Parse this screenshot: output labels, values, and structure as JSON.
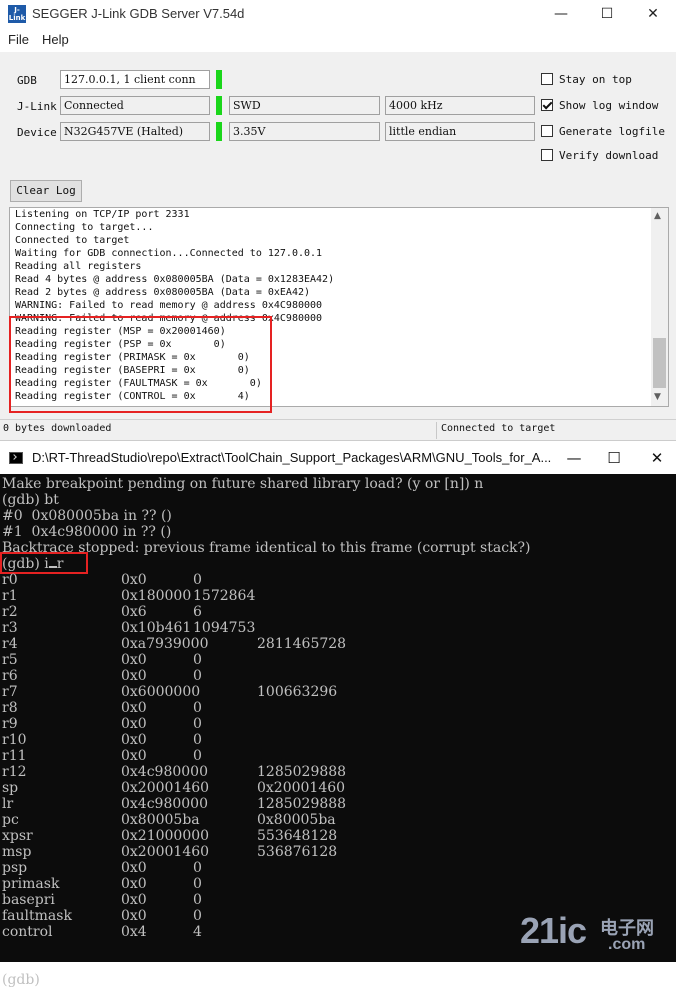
{
  "server": {
    "title": "SEGGER J-Link GDB Server V7.54d",
    "icon_text": "J-Link GDB",
    "menu": [
      "File",
      "Help"
    ],
    "labels": {
      "gdb": "GDB",
      "jlink": "J-Link",
      "device": "Device"
    },
    "fields": {
      "gdb": "127.0.0.1, 1 client conn",
      "jlink": "Connected",
      "interface": "SWD",
      "speed": "4000 kHz",
      "device": "N32G457VE (Halted)",
      "voltage": "3.35V",
      "endian": "little endian"
    },
    "options": [
      {
        "label": "Stay on top",
        "checked": false
      },
      {
        "label": "Show log window",
        "checked": true
      },
      {
        "label": "Generate logfile",
        "checked": false
      },
      {
        "label": "Verify download",
        "checked": false
      }
    ],
    "clear_log": "Clear Log",
    "log": [
      "Listening on TCP/IP port 2331",
      "Connecting to target...",
      "Connected to target",
      "Waiting for GDB connection...Connected to 127.0.0.1",
      "Reading all registers",
      "Read 4 bytes @ address 0x080005BA (Data = 0x1283EA42)",
      "Read 2 bytes @ address 0x080005BA (Data = 0xEA42)",
      "WARNING: Failed to read memory @ address 0x4C980000",
      "WARNING: Failed to read memory @ address 0x4C980000",
      "Reading register (MSP = 0x20001460)",
      "Reading register (PSP = 0x       0)",
      "Reading register (PRIMASK = 0x       0)",
      "Reading register (BASEPRI = 0x       0)",
      "Reading register (FAULTMASK = 0x       0)",
      "Reading register (CONTROL = 0x       4)"
    ],
    "status_left": "0 bytes downloaded",
    "status_right": "Connected to target",
    "colors": {
      "led": "#1ad61a",
      "highlight": "#e52222"
    }
  },
  "console": {
    "title": "D:\\RT-ThreadStudio\\repo\\Extract\\ToolChain_Support_Packages\\ARM\\GNU_Tools_for_A...",
    "lines": [
      "Make breakpoint pending on future shared library load? (y or [n]) n",
      "(gdb) bt",
      "#0  0x080005ba in ?? ()",
      "#1  0x4c980000 in ?? ()",
      "Backtrace stopped: previous frame identical to this frame (corrupt stack?)"
    ],
    "prompt_prefix": "(gdb) i",
    "prompt_suffix": "r",
    "registers": [
      {
        "name": "r0",
        "hex": "0x0",
        "natural": "0"
      },
      {
        "name": "r1",
        "hex": "0x180000",
        "natural": "1572864"
      },
      {
        "name": "r2",
        "hex": "0x6",
        "natural": "6"
      },
      {
        "name": "r3",
        "hex": "0x10b461",
        "natural": "1094753"
      },
      {
        "name": "r4",
        "hex": "0xa7939000",
        "natural": "2811465728"
      },
      {
        "name": "r5",
        "hex": "0x0",
        "natural": "0"
      },
      {
        "name": "r6",
        "hex": "0x0",
        "natural": "0"
      },
      {
        "name": "r7",
        "hex": "0x6000000",
        "natural": "100663296"
      },
      {
        "name": "r8",
        "hex": "0x0",
        "natural": "0"
      },
      {
        "name": "r9",
        "hex": "0x0",
        "natural": "0"
      },
      {
        "name": "r10",
        "hex": "0x0",
        "natural": "0"
      },
      {
        "name": "r11",
        "hex": "0x0",
        "natural": "0"
      },
      {
        "name": "r12",
        "hex": "0x4c980000",
        "natural": "1285029888"
      },
      {
        "name": "sp",
        "hex": "0x20001460",
        "natural": "0x20001460"
      },
      {
        "name": "lr",
        "hex": "0x4c980000",
        "natural": "1285029888"
      },
      {
        "name": "pc",
        "hex": "0x80005ba",
        "natural": "0x80005ba"
      },
      {
        "name": "xpsr",
        "hex": "0x21000000",
        "natural": "553648128"
      },
      {
        "name": "msp",
        "hex": "0x20001460",
        "natural": "536876128"
      },
      {
        "name": "psp",
        "hex": "0x0",
        "natural": "0"
      },
      {
        "name": "primask",
        "hex": "0x0",
        "natural": "0"
      },
      {
        "name": "basepri",
        "hex": "0x0",
        "natural": "0"
      },
      {
        "name": "faultmask",
        "hex": "0x0",
        "natural": "0"
      },
      {
        "name": "control",
        "hex": "0x4",
        "natural": "4"
      }
    ],
    "final_prompt": "(gdb)"
  },
  "watermark": {
    "big": "21ic",
    "small": "电子网",
    "domain": ".com"
  }
}
